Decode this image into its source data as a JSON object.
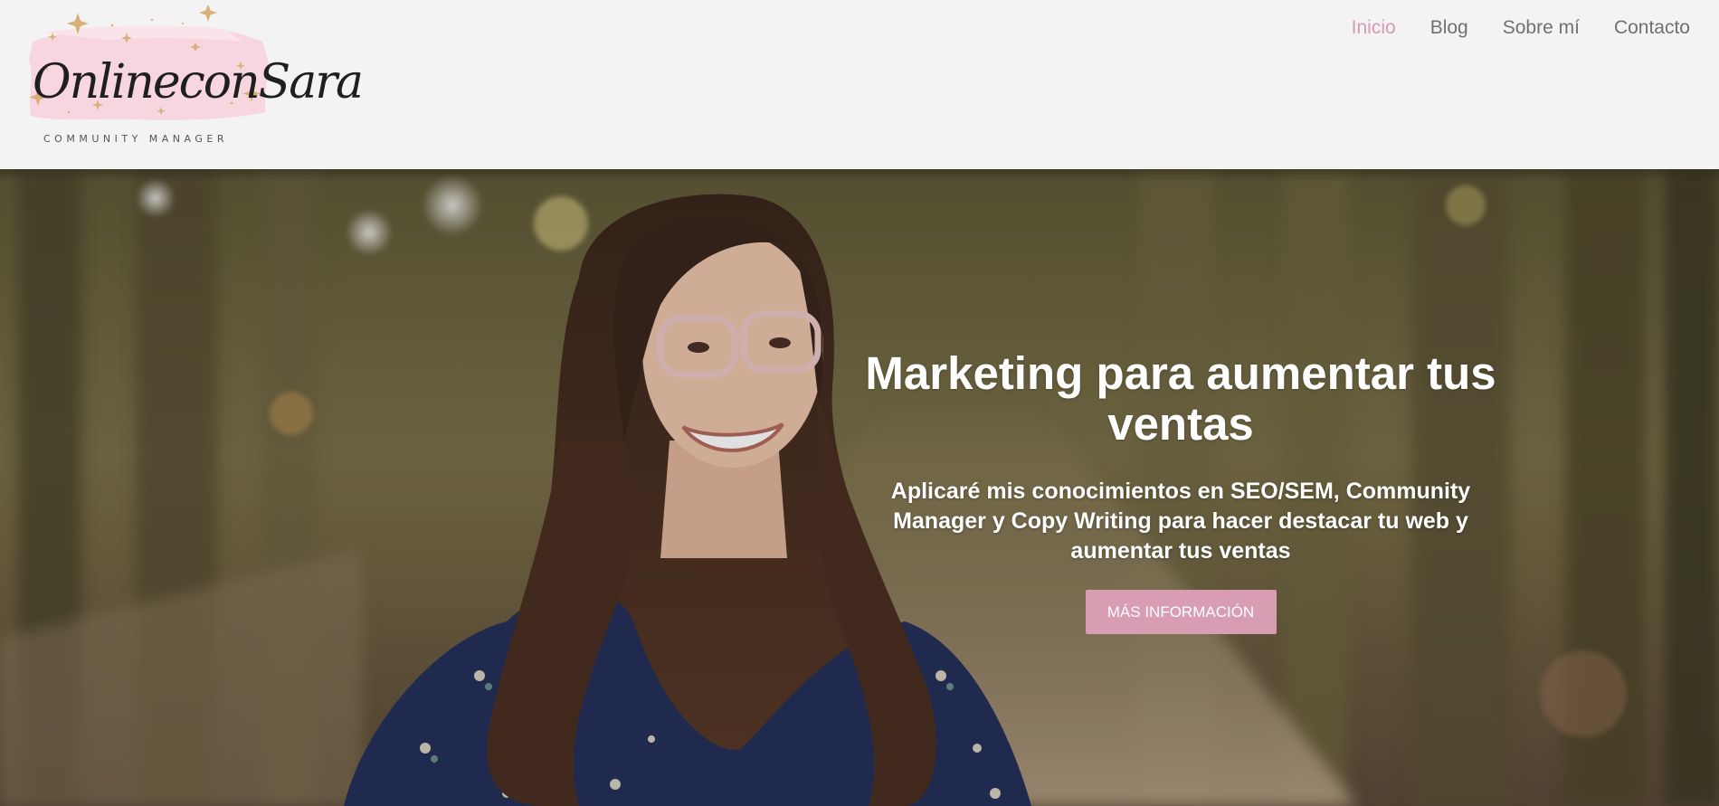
{
  "header": {
    "logo": {
      "script_text": "OnlineconSara",
      "subtitle": "COMMUNITY MANAGER"
    },
    "nav": [
      {
        "label": "Inicio",
        "active": true
      },
      {
        "label": "Blog",
        "active": false
      },
      {
        "label": "Sobre mí",
        "active": false
      },
      {
        "label": "Contacto",
        "active": false
      }
    ]
  },
  "hero": {
    "title": "Marketing para aumentar tus ventas",
    "subtitle": "Aplicaré mis conocimientos en SEO/SEM, Community Manager y Copy Writing para hacer destacar tu web y aumentar tus ventas",
    "button_label": "MÁS INFORMACIÓN"
  },
  "colors": {
    "accent_pink": "#d79ab5",
    "button_pink": "#d89cb3",
    "nav_gray": "#707070",
    "header_bg": "#f3f3f3"
  }
}
